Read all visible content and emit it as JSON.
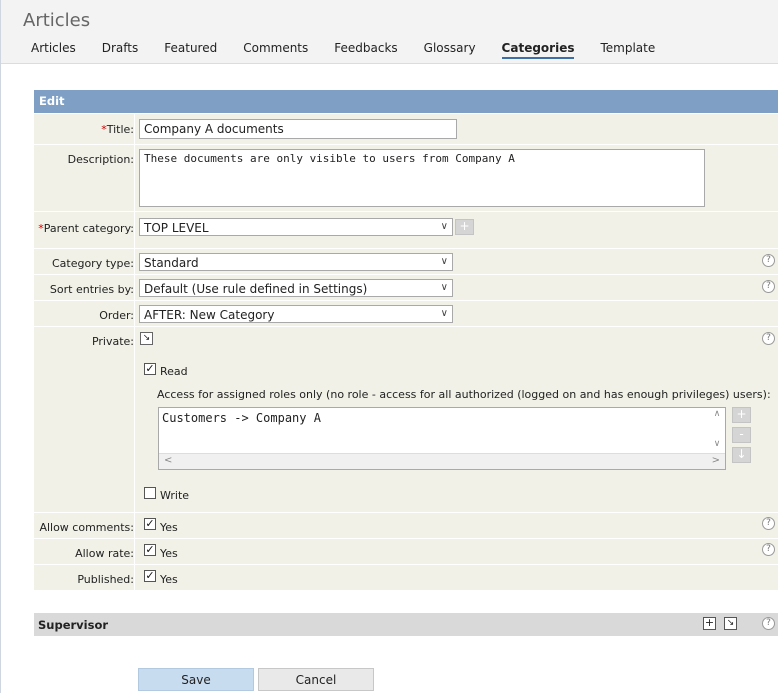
{
  "app": {
    "title": "Articles"
  },
  "tabs": [
    {
      "label": "Articles"
    },
    {
      "label": "Drafts"
    },
    {
      "label": "Featured"
    },
    {
      "label": "Comments"
    },
    {
      "label": "Feedbacks"
    },
    {
      "label": "Glossary"
    },
    {
      "label": "Categories"
    },
    {
      "label": "Template"
    }
  ],
  "active_tab": "Categories",
  "edit": {
    "header": "Edit",
    "title_label": "Title:",
    "title_value": "Company A documents",
    "description_label": "Description:",
    "description_value": "These documents are only visible to users from Company A",
    "parent_label": "Parent category:",
    "parent_value": "TOP LEVEL",
    "category_type_label": "Category type:",
    "category_type_value": "Standard",
    "sort_label": "Sort entries by:",
    "sort_value": "Default (Use rule defined in Settings)",
    "order_label": "Order:",
    "order_value": "AFTER: New Category",
    "private_label": "Private:",
    "read_label": "Read",
    "access_note": "Access for assigned roles only (no role - access for all authorized (logged on and has enough privileges) users):",
    "roles": [
      "Customers -> Company A"
    ],
    "write_label": "Write",
    "allow_comments_label": "Allow comments:",
    "allow_rate_label": "Allow rate:",
    "published_label": "Published:",
    "yes": "Yes",
    "required_mark": "*"
  },
  "supervisor": {
    "title": "Supervisor"
  },
  "buttons": {
    "save": "Save",
    "cancel": "Cancel"
  },
  "colors": {
    "panel_header": "#7fa0c4",
    "row_bg": "#f1f1e8",
    "save_bg": "#c8dcf0",
    "active_tab_underline": "#3c6fa5"
  }
}
